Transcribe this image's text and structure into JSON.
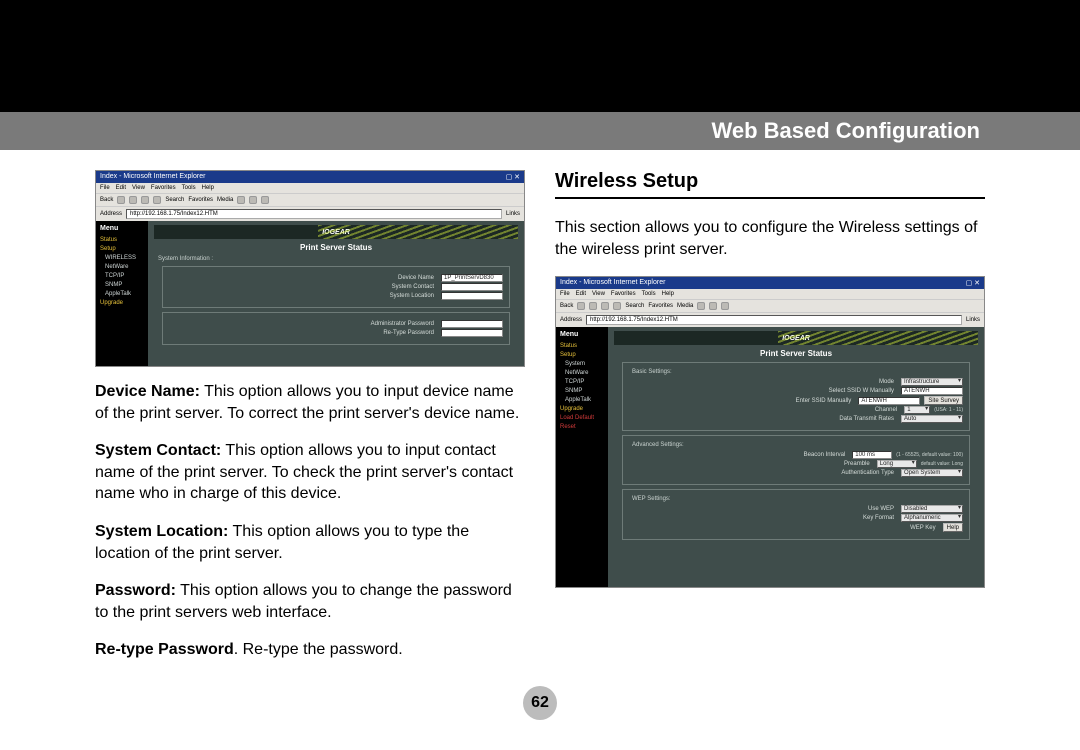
{
  "header": {
    "title": "Web Based Configuration"
  },
  "page_number": "62",
  "left": {
    "screenshot": {
      "title": "Index - Microsoft Internet Explorer",
      "menus": [
        "File",
        "Edit",
        "View",
        "Favorites",
        "Tools",
        "Help"
      ],
      "toolbar": [
        "Back",
        "Search",
        "Favorites",
        "Media"
      ],
      "address_label": "Address",
      "address": "http://192.168.1.75/Index12.HTM",
      "links_label": "Links",
      "sidebar_heading": "Menu",
      "sidebar": [
        {
          "label": "Status",
          "class": "lnk-yellow"
        },
        {
          "label": "Setup",
          "class": "lnk-yellow"
        },
        {
          "label": "WIRELESS",
          "class": "lnk-sub"
        },
        {
          "label": "NetWare",
          "class": "lnk-sub"
        },
        {
          "label": "TCP/IP",
          "class": "lnk-sub"
        },
        {
          "label": "SNMP",
          "class": "lnk-sub"
        },
        {
          "label": "AppleTalk",
          "class": "lnk-sub"
        },
        {
          "label": "Upgrade",
          "class": "lnk-yellow"
        }
      ],
      "iogear": "IOGEAR",
      "pss_title": "Print Server Status",
      "section_label": "System Information :",
      "rows": [
        {
          "label": "Device Name",
          "value": "1P_PrintServD830"
        },
        {
          "label": "System Contact",
          "value": ""
        },
        {
          "label": "System Location",
          "value": ""
        },
        {
          "label": "Administrator Password",
          "value": ""
        },
        {
          "label": "Re-Type Password",
          "value": ""
        }
      ]
    },
    "paragraphs": [
      {
        "bold": "Device Name:",
        "text": " This option allows you to input device name of the print server. To correct the print server's device name."
      },
      {
        "bold": "System Contact:",
        "text": " This option allows you to input contact name of the print server. To check the print server's contact name who in charge of this device."
      },
      {
        "bold": "System Location:",
        "text": " This option allows you to type the location of the print server."
      },
      {
        "bold": "Password:",
        "text": " This option allows you to change the password to the print servers web interface."
      },
      {
        "bold": "Re-type Password",
        "text": ". Re-type the password."
      }
    ]
  },
  "right": {
    "section_title": "Wireless Setup",
    "intro": "This section allows you to configure the Wireless settings of the wireless print server.",
    "screenshot": {
      "title": "Index - Microsoft Internet Explorer",
      "menus": [
        "File",
        "Edit",
        "View",
        "Favorites",
        "Tools",
        "Help"
      ],
      "toolbar": [
        "Back",
        "Search",
        "Favorites",
        "Media"
      ],
      "address_label": "Address",
      "address": "http://192.168.1.75/Index12.HTM",
      "links_label": "Links",
      "sidebar_heading": "Menu",
      "sidebar": [
        {
          "label": "Status",
          "class": "lnk-yellow"
        },
        {
          "label": "Setup",
          "class": "lnk-yellow"
        },
        {
          "label": "System",
          "class": "lnk-sub"
        },
        {
          "label": "NetWare",
          "class": "lnk-sub"
        },
        {
          "label": "TCP/IP",
          "class": "lnk-sub"
        },
        {
          "label": "SNMP",
          "class": "lnk-sub"
        },
        {
          "label": "AppleTalk",
          "class": "lnk-sub"
        },
        {
          "label": "Upgrade",
          "class": "lnk-yellow"
        },
        {
          "label": "Load Default",
          "class": "lnk-red"
        },
        {
          "label": "Reset",
          "class": "lnk-red"
        }
      ],
      "iogear": "IOGEAR",
      "pss_title": "Print Server Status",
      "basic_label": "Basic Settings:",
      "basic_rows": [
        {
          "label": "Mode",
          "type": "select",
          "value": "Infrastructure"
        },
        {
          "label": "Select SSID W Manually",
          "type": "input",
          "value": "ATENWH"
        },
        {
          "label": "Enter SSID Manually",
          "type": "input",
          "value": "ATENWH",
          "button": "Site Survey"
        },
        {
          "label": "Channel",
          "type": "select",
          "value": "1",
          "hint": "(USA: 1 - 11)"
        },
        {
          "label": "Data Transmit Rates",
          "type": "select",
          "value": "Auto"
        }
      ],
      "advanced_label": "Advanced Settings:",
      "advanced_rows": [
        {
          "label": "Beacon Interval",
          "type": "input",
          "value": "100 ms",
          "hint": "(1 - 65525, default value: 100)"
        },
        {
          "label": "Preamble",
          "type": "select",
          "value": "Long",
          "hint": "default value: Long"
        },
        {
          "label": "Authentication Type",
          "type": "select",
          "value": "Open System"
        }
      ],
      "wep_label": "WEP Settings:",
      "wep_rows": [
        {
          "label": "Use WEP",
          "type": "select",
          "value": "Disabled"
        },
        {
          "label": "Key Format",
          "type": "select",
          "value": "Alphanumeric"
        },
        {
          "label": "WEP Key",
          "type": "button",
          "value": "Help"
        }
      ]
    }
  }
}
